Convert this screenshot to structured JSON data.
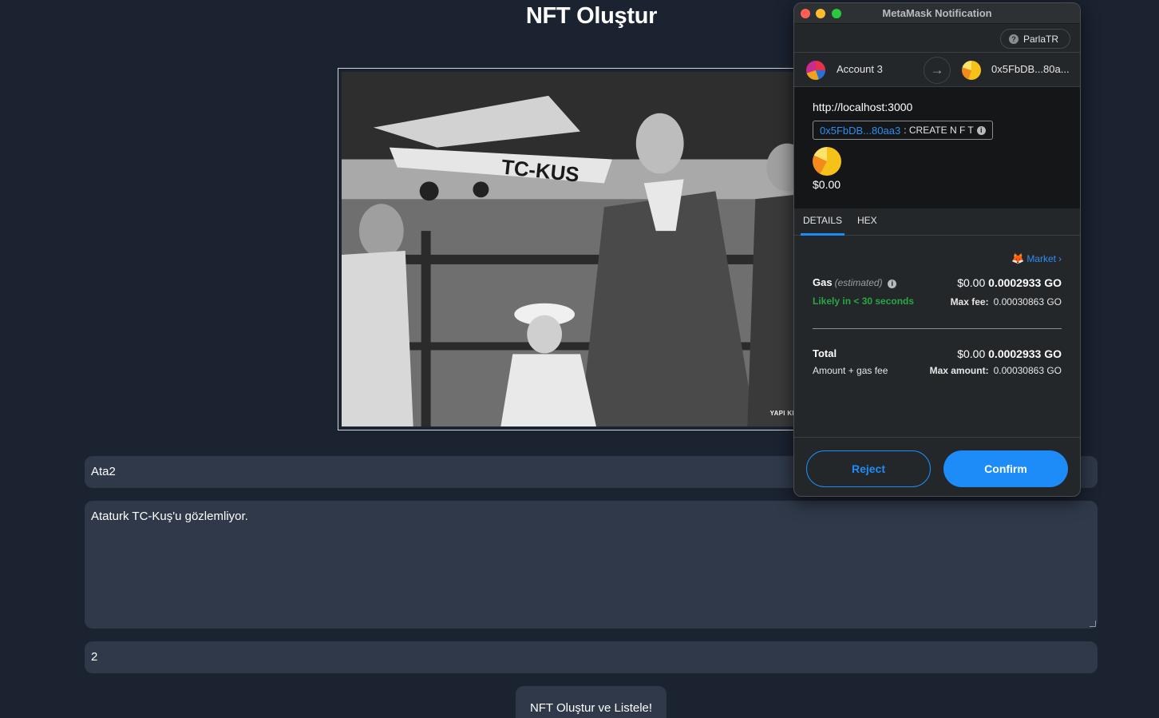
{
  "page": {
    "title": "NFT Oluştur",
    "name_value": "Ata2",
    "description_value": "Ataturk TC-Kuş'u gözlemliyor.",
    "price_value": "2",
    "submit_label": "NFT Oluştur ve Listele!",
    "photo_watermark": "YAPI KREDİ TAR",
    "photo_plane_marking": "TC-KUS"
  },
  "metamask": {
    "window_title": "MetaMask Notification",
    "network": "ParlaTR",
    "from_account": "Account 3",
    "to_address": "0x5FbDB...80a...",
    "origin": "http://localhost:3000",
    "method_address": "0x5FbDB...80aa3",
    "method_name": ": CREATE N F T",
    "summary_amount": "$0.00",
    "tabs": [
      "DETAILS",
      "HEX"
    ],
    "market_label": "Market",
    "gas_label": "Gas",
    "gas_estimated": "(estimated)",
    "gas_fiat": "$0.00",
    "gas_amount": "0.0002933 GO",
    "likely_text": "Likely in < 30 seconds",
    "max_fee_label": "Max fee:",
    "max_fee_value": "0.00030863 GO",
    "total_label": "Total",
    "total_fiat": "$0.00",
    "total_amount": "0.0002933 GO",
    "total_sub": "Amount + gas fee",
    "max_amount_label": "Max amount:",
    "max_amount_value": "0.00030863 GO",
    "reject_label": "Reject",
    "confirm_label": "Confirm"
  },
  "colors": {
    "page_bg": "#1b2230",
    "field_bg": "#2f3949",
    "mm_bg": "#24272a",
    "mm_accent": "#1d8cf8",
    "likely_green": "#28a745"
  }
}
